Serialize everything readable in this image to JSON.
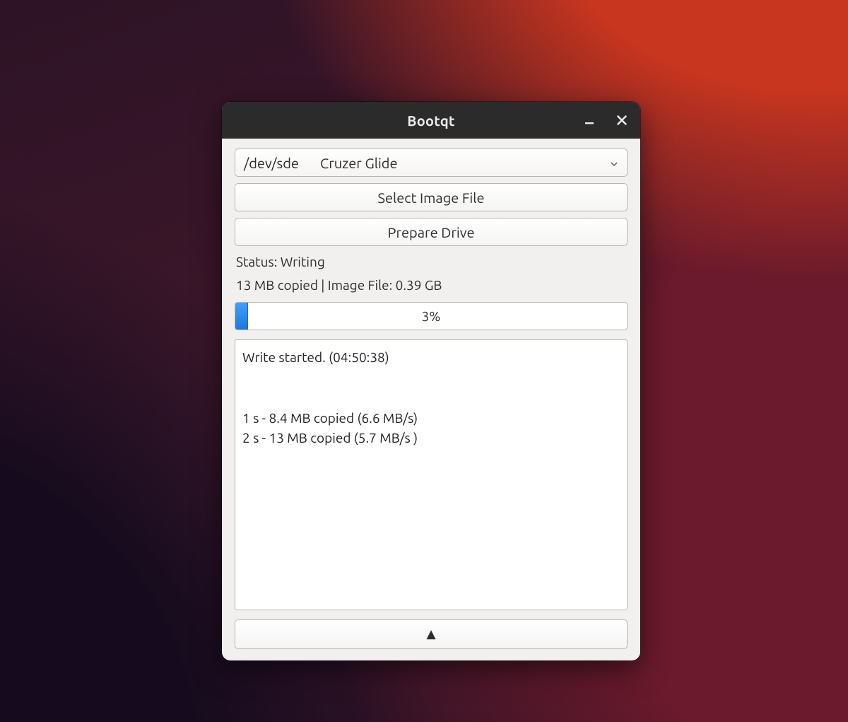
{
  "window": {
    "title": "Bootqt"
  },
  "drive": {
    "device": "/dev/sde",
    "label": "Cruzer Glide"
  },
  "buttons": {
    "select_image": "Select Image File",
    "prepare_drive": "Prepare Drive",
    "collapse_glyph": "▲"
  },
  "status": {
    "line": "Status: Writing",
    "progress_text": "13 MB copied | Image File: 0.39 GB"
  },
  "progress": {
    "percent_label": "3%",
    "percent_value": 3
  },
  "log_text": "Write started. (04:50:38)\n\n\n1 s - 8.4 MB copied (6.6 MB/s)\n2 s - 13 MB copied (5.7 MB/s )"
}
